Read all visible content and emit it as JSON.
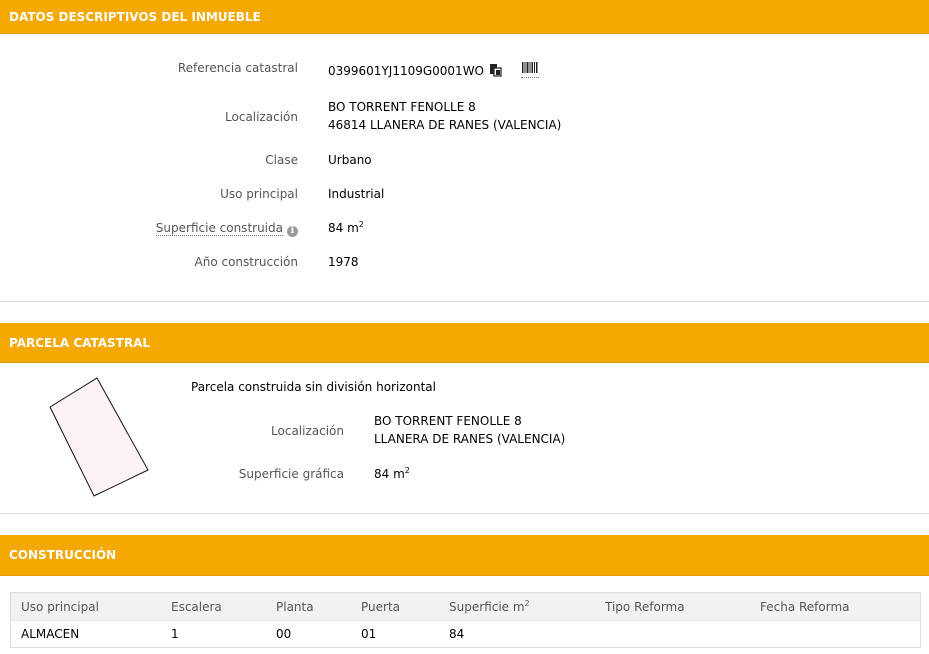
{
  "section_inmueble": {
    "title": "DATOS DESCRIPTIVOS DEL INMUEBLE",
    "referencia_label": "Referencia catastral",
    "referencia_value": "0399601YJ1109G0001WO",
    "localizacion_label": "Localización",
    "localizacion_line1": "BO TORRENT FENOLLE 8",
    "localizacion_line2": "46814 LLANERA DE RANES (VALENCIA)",
    "clase_label": "Clase",
    "clase_value": "Urbano",
    "uso_label": "Uso principal",
    "uso_value": "Industrial",
    "superficie_label": "Superficie construida",
    "superficie_value": "84 m",
    "superficie_sup": "2",
    "info_icon_glyph": "i",
    "anio_label": "Año construcción",
    "anio_value": "1978",
    "icons": [
      "copy-icon",
      "barcode-icon"
    ]
  },
  "section_parcela": {
    "title": "PARCELA CATASTRAL",
    "subtitle": "Parcela construida sin división horizontal",
    "localizacion_label": "Localización",
    "localizacion_line1": "BO TORRENT FENOLLE 8",
    "localizacion_line2": "LLANERA DE RANES (VALENCIA)",
    "superficie_label": "Superficie gráfica",
    "superficie_value": "84 m",
    "superficie_sup": "2",
    "shape_fill": "#fdf3f5"
  },
  "section_construccion": {
    "title": "CONSTRUCCIÓN",
    "columns": [
      "Uso principal",
      "Escalera",
      "Planta",
      "Puerta",
      "Superficie m",
      "Tipo Reforma",
      "Fecha Reforma"
    ],
    "superficie_col_sup": "2",
    "rows": [
      [
        "ALMACEN",
        "1",
        "00",
        "01",
        "84",
        "",
        ""
      ]
    ]
  },
  "colors": {
    "header_bg": "#f5a800",
    "header_text": "#ffffff"
  }
}
